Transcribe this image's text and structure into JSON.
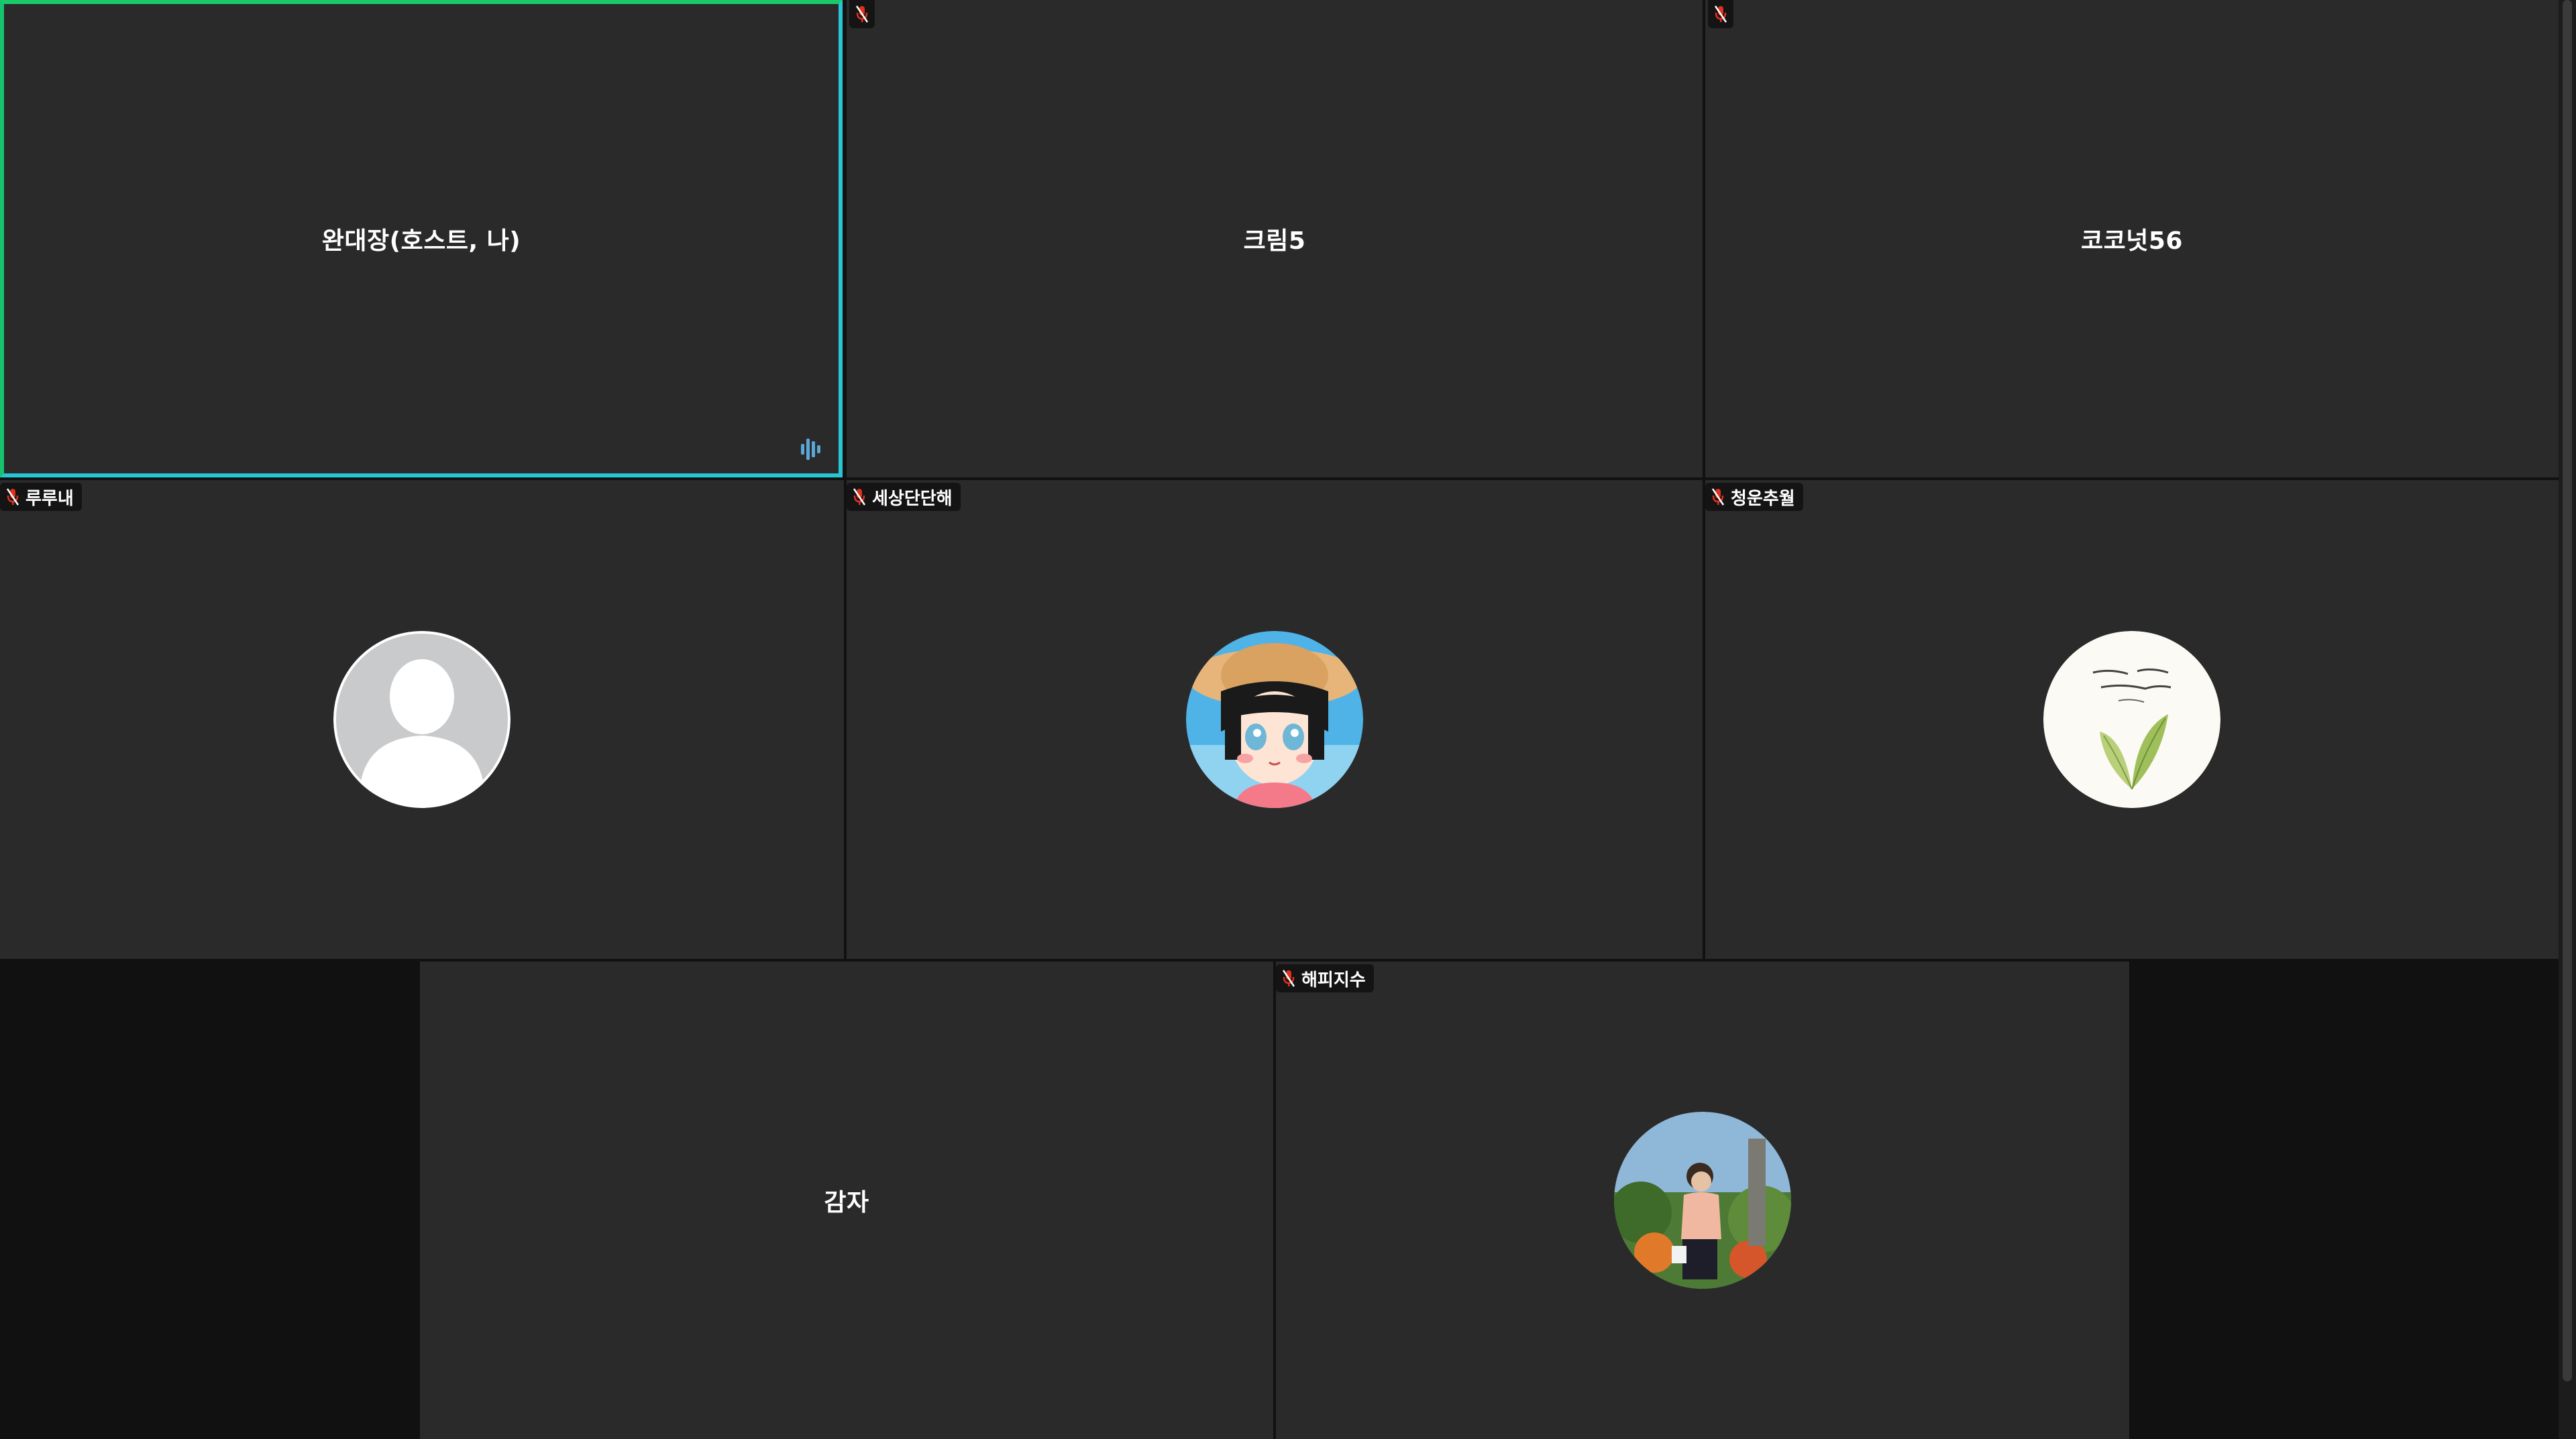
{
  "tiles": [
    {
      "name": "완대장(호스트, 나)",
      "style": "name",
      "muted": false,
      "speaking": true
    },
    {
      "name": "크림5",
      "style": "name",
      "muted": true
    },
    {
      "name": "코코넛56",
      "style": "name",
      "muted": true
    },
    {
      "name": "루루내",
      "style": "avatar",
      "avatar": "default-person-avatar",
      "muted": true
    },
    {
      "name": "세상단단해",
      "style": "avatar",
      "avatar": "cartoon-girl-avatar",
      "muted": true
    },
    {
      "name": "청운추월",
      "style": "avatar",
      "avatar": "leaf-calligraphy-avatar",
      "muted": true
    },
    {
      "name": "감자",
      "style": "name",
      "muted": false
    },
    {
      "name": "해피지수",
      "style": "avatar",
      "avatar": "photo-woman-avatar",
      "muted": true
    }
  ],
  "colors": {
    "tile_bg": "#2a2a2a",
    "stage_bg": "#111111",
    "active_border": "#28c6d4",
    "muted_icon": "#e0301e",
    "speaking_icon": "#5aa7d8"
  }
}
